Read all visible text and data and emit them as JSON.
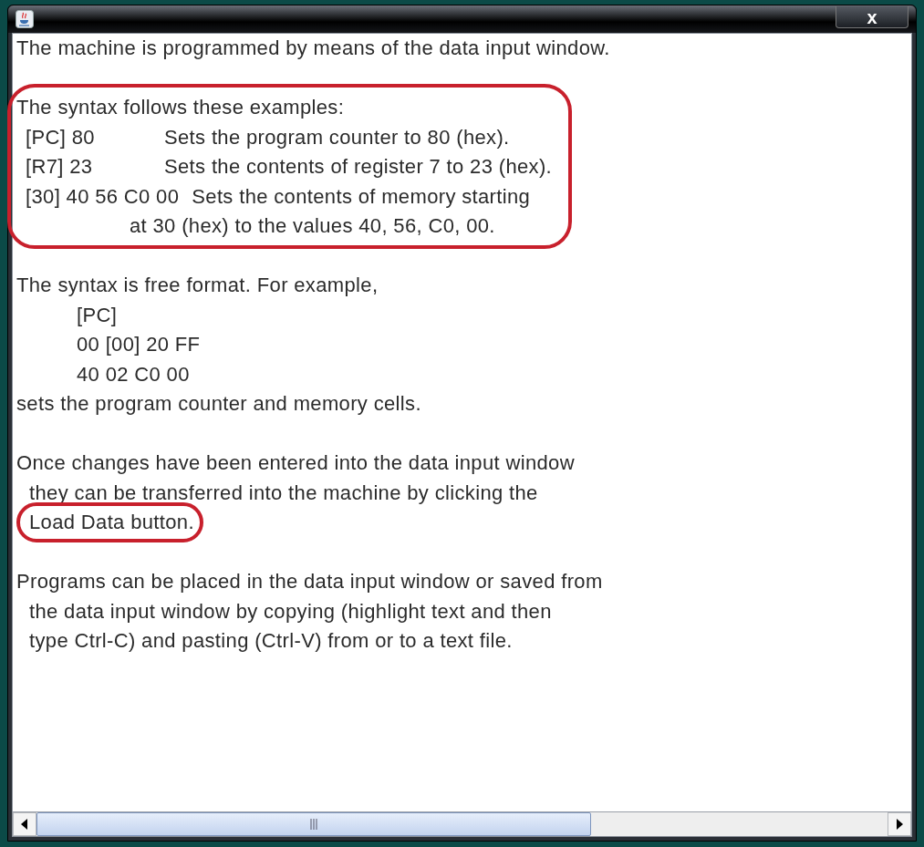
{
  "title_bar": {
    "close_label": "x"
  },
  "blocks": [
    {
      "lines": [
        {
          "kind": "plain",
          "text": "The machine is programmed by means of the data input window."
        }
      ]
    },
    {
      "circled": true,
      "lines": [
        {
          "kind": "plain",
          "text": "The syntax follows these examples:"
        },
        {
          "kind": "pair",
          "code": "[PC] 80",
          "text": "Sets the program counter to 80 (hex)."
        },
        {
          "kind": "pair",
          "code": "[R7] 23",
          "text": "Sets the contents of register 7 to 23 (hex)."
        },
        {
          "kind": "pair",
          "code": "[30] 40 56 C0 00",
          "text": "Sets the contents of memory starting"
        },
        {
          "kind": "continuation",
          "text": "at 30 (hex) to the values 40, 56, C0, 00."
        }
      ]
    },
    {
      "lines": [
        {
          "kind": "plain",
          "text": "The syntax is free format. For example,"
        },
        {
          "kind": "nested",
          "text": "[PC]"
        },
        {
          "kind": "nested",
          "text": "00 [00] 20 FF"
        },
        {
          "kind": "nested",
          "text": "40 02 C0 00"
        },
        {
          "kind": "plain",
          "text": "sets the program counter and memory cells."
        }
      ]
    },
    {
      "lines": [
        {
          "kind": "plain",
          "text": "Once changes have been entered into the data input window"
        },
        {
          "kind": "indented",
          "text": "they can be transferred into the machine by clicking the"
        },
        {
          "kind": "indented",
          "text": "Load Data button.",
          "circled": true
        }
      ]
    },
    {
      "lines": [
        {
          "kind": "plain",
          "text": "Programs can be placed in the data input window or saved from"
        },
        {
          "kind": "indented",
          "text": "the data input window by copying (highlight text and then"
        },
        {
          "kind": "indented",
          "text": "type Ctrl-C) and pasting (Ctrl-V) from or to a text file."
        }
      ]
    }
  ]
}
